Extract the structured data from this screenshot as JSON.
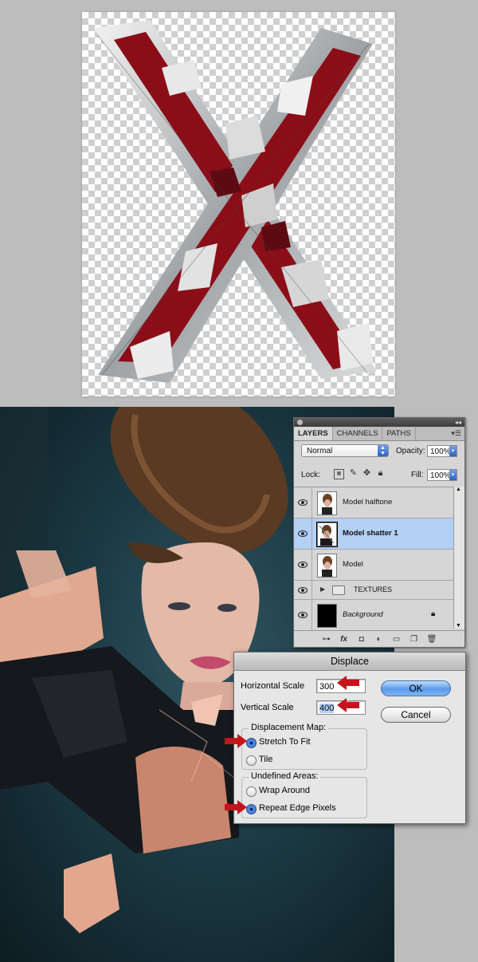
{
  "layers_panel": {
    "tabs": [
      "LAYERS",
      "CHANNELS",
      "PATHS"
    ],
    "blend_mode": "Normal",
    "opacity_label": "Opacity:",
    "opacity_value": "100%",
    "lock_label": "Lock:",
    "fill_label": "Fill:",
    "fill_value": "100%",
    "layers": [
      {
        "name": "Model halftone"
      },
      {
        "name": "Model shatter 1"
      },
      {
        "name": "Model"
      },
      {
        "name": "TEXTURES"
      },
      {
        "name": "Background"
      }
    ]
  },
  "dialog": {
    "title": "Displace",
    "horizontal_scale_label": "Horizontal Scale",
    "horizontal_scale_value": "300",
    "vertical_scale_label": "Vertical Scale",
    "vertical_scale_value": "400",
    "ok_label": "OK",
    "cancel_label": "Cancel",
    "displacement_map_legend": "Displacement Map:",
    "stretch_label": "Stretch To Fit",
    "tile_label": "Tile",
    "undefined_areas_legend": "Undefined Areas:",
    "wrap_label": "Wrap Around",
    "repeat_label": "Repeat Edge Pixels"
  },
  "colors": {
    "canvas_gray": "#bdbdbd",
    "shatter_red": "#8b0d18",
    "selection_blue": "#b3d0f5",
    "pointer_arrow_red": "#c4151c"
  }
}
